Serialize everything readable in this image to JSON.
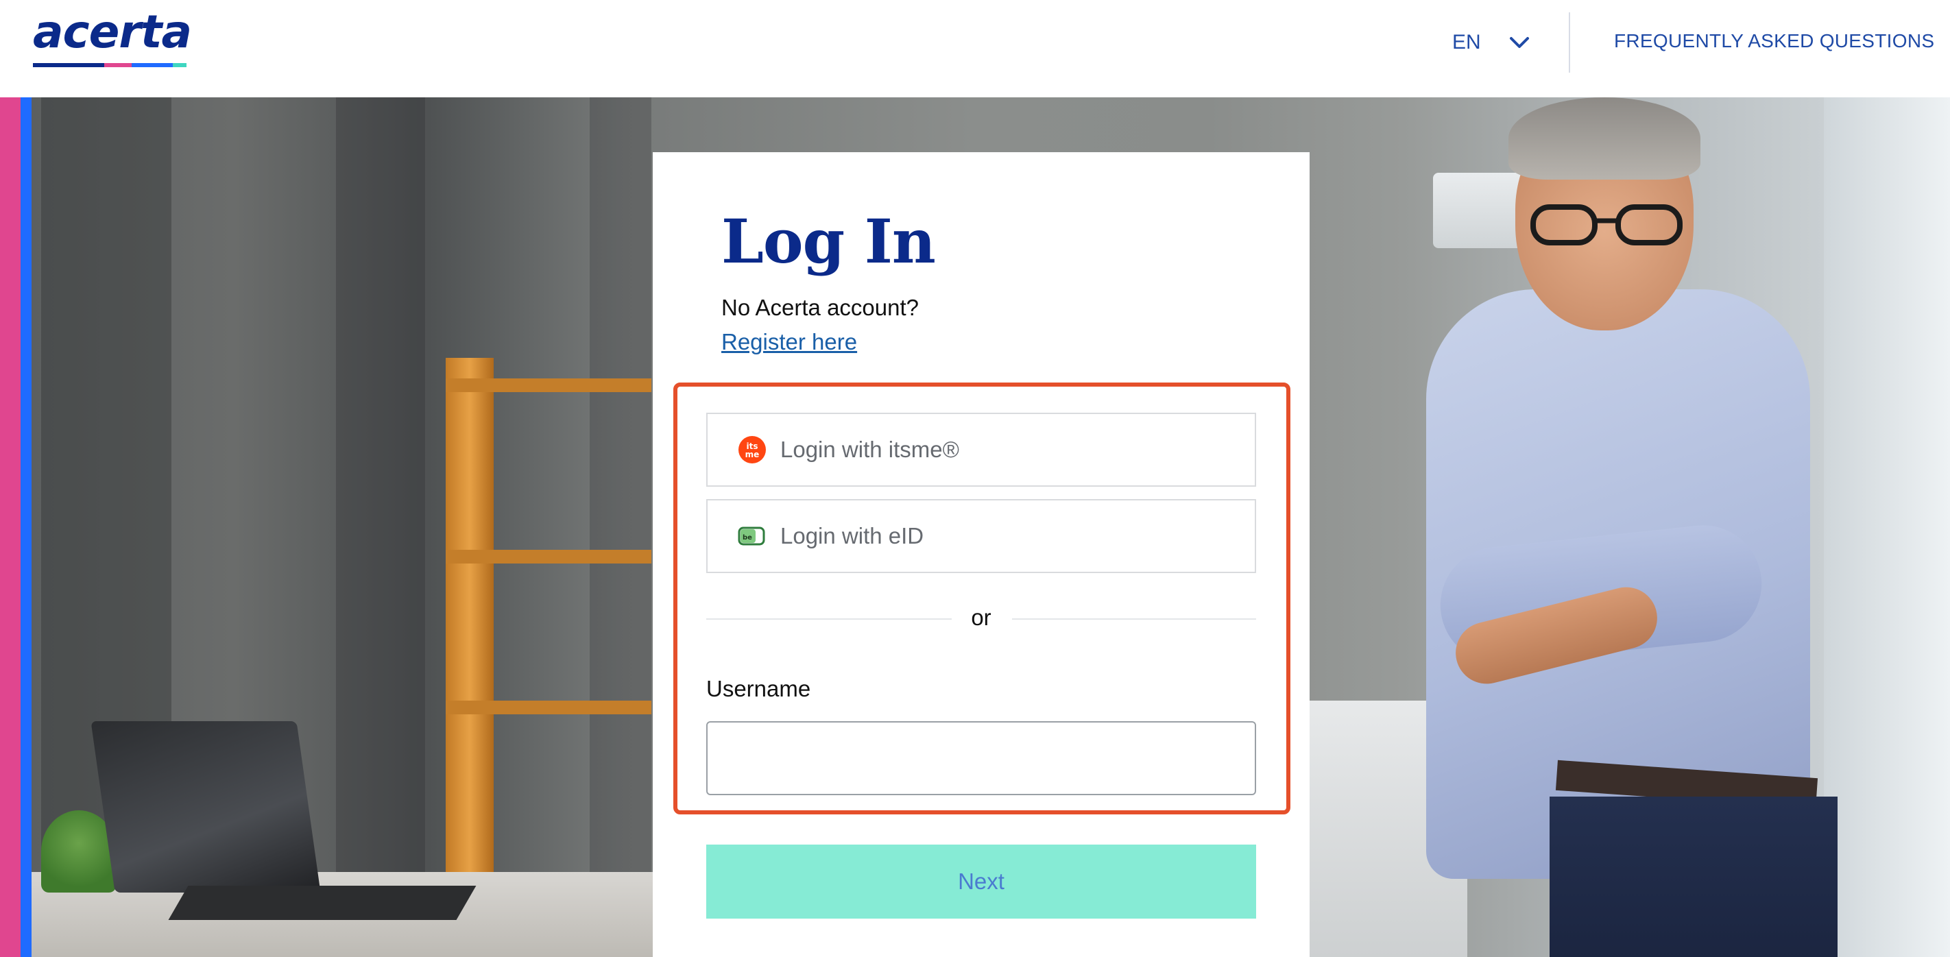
{
  "header": {
    "logo_text": "acerta",
    "language": "EN",
    "faq_label": "FREQUENTLY ASKED QUESTIONS"
  },
  "login": {
    "title": "Log In",
    "no_account_text": "No Acerta account?",
    "register_link": "Register here",
    "itsme_label": "Login with itsme®",
    "eid_label": "Login with eID",
    "or_text": "or",
    "username_label": "Username",
    "username_value": "",
    "next_label": "Next"
  },
  "icons": {
    "itsme": "itsme-icon",
    "eid": "eid-card-icon",
    "language_chevron": "chevron-down-icon"
  },
  "colors": {
    "brand_navy": "#0b2a8a",
    "link_blue": "#1f4aa6",
    "highlight_border": "#e5502b",
    "next_button_bg": "#86ebd5",
    "stripe_pink": "#e0468f",
    "stripe_blue": "#1f6bff",
    "itsme_orange": "#ff4612"
  }
}
